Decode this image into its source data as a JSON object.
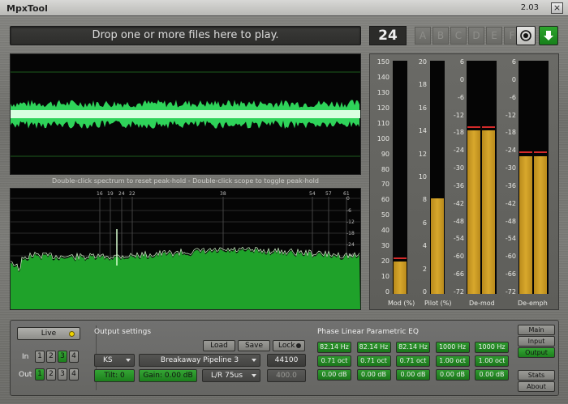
{
  "window": {
    "title": "MpxTool",
    "version": "2.03",
    "close": "×"
  },
  "top": {
    "drop_text": "Drop one or more files here to play.",
    "counter": "24",
    "presets": [
      "A",
      "B",
      "C",
      "D",
      "E",
      "F"
    ]
  },
  "hint": "Double-click spectrum to reset peak-hold - Double-click scope to toggle peak-hold",
  "spectrum": {
    "markers": [
      "16",
      "19",
      "24",
      "22",
      "38",
      "54",
      "57",
      "61"
    ],
    "db_scale": [
      "0",
      "-6",
      "-12",
      "-18",
      "-24",
      "-30"
    ]
  },
  "meters": {
    "mod": {
      "label": "Mod (%)",
      "scale": [
        "150",
        "140",
        "130",
        "120",
        "110",
        "100",
        "90",
        "80",
        "70",
        "60",
        "50",
        "40",
        "30",
        "20",
        "10",
        "0"
      ],
      "level": 0.14,
      "peak": 0.145
    },
    "pilot": {
      "label": "Pilot (%)",
      "scale": [
        "20",
        "18",
        "16",
        "14",
        "12",
        "10",
        "8",
        "6",
        "4",
        "2",
        "0"
      ],
      "level": 0.41
    },
    "demod": {
      "label": "De-mod",
      "scale": [
        "6",
        "0",
        "-6",
        "-12",
        "-18",
        "-24",
        "-30",
        "-36",
        "-42",
        "-48",
        "-54",
        "-60",
        "-66",
        "-72"
      ],
      "level_l": 0.7,
      "level_r": 0.7,
      "peak_l": 0.71,
      "peak_r": 0.71
    },
    "deemph": {
      "label": "De-emph",
      "scale": [
        "6",
        "0",
        "-6",
        "-12",
        "-18",
        "-24",
        "-30",
        "-36",
        "-42",
        "-48",
        "-54",
        "-60",
        "-66",
        "-72"
      ],
      "level_l": 0.59,
      "level_r": 0.59,
      "peak_l": 0.6,
      "peak_r": 0.6
    }
  },
  "controls": {
    "live": "Live",
    "in_label": "In",
    "out_label": "Out",
    "in_channels": [
      "1",
      "2",
      "3",
      "4"
    ],
    "out_channels": [
      "1",
      "2",
      "3",
      "4"
    ],
    "in_active": 3,
    "out_active": 1,
    "output_settings": "Output settings",
    "load": "Load",
    "save": "Save",
    "lock": "Lock",
    "ks": "KS",
    "pipeline": "Breakaway Pipeline 3",
    "samplerate": "44100",
    "tilt": "Tilt: 0",
    "gain": "Gain: 0.00 dB",
    "lr": "L/R 75us",
    "ratio": "400.0",
    "eq_title": "Phase Linear Parametric EQ",
    "eq_freq": [
      "82.14 Hz",
      "82.14 Hz",
      "82.14 Hz",
      "1000 Hz",
      "1000 Hz"
    ],
    "eq_oct": [
      "0.71 oct",
      "0.71 oct",
      "0.71 oct",
      "1.00 oct",
      "1.00 oct"
    ],
    "eq_gain": [
      "0.00 dB",
      "0.00 dB",
      "0.00 dB",
      "0.00 dB",
      "0.00 dB"
    ],
    "tabs": [
      "Main",
      "Input",
      "Output"
    ],
    "stats": "Stats",
    "about": "About"
  }
}
